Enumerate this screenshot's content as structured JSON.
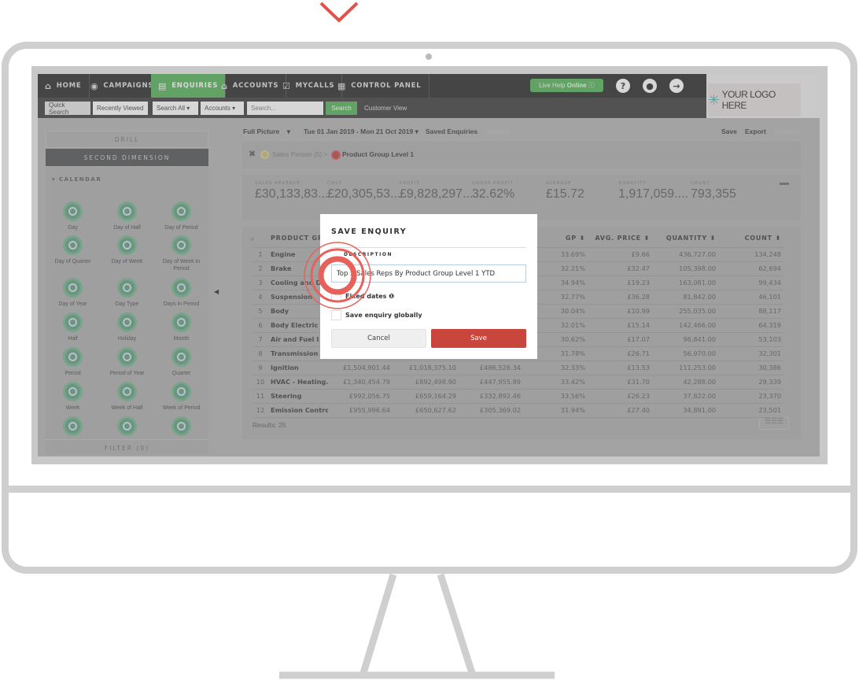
{
  "nav": {
    "items": [
      {
        "label": "HOME",
        "icon": "home-icon"
      },
      {
        "label": "CAMPAIGNS",
        "icon": "campaign-icon"
      },
      {
        "label": "ENQUIRIES",
        "icon": "enquiries-icon",
        "active": true
      },
      {
        "label": "ACCOUNTS",
        "icon": "bank-icon"
      },
      {
        "label": "MYCALLS",
        "icon": "checklist-icon"
      },
      {
        "label": "CONTROL PANEL",
        "icon": "control-panel-icon"
      }
    ],
    "live_help": "Live Help",
    "live_help_status": "Online",
    "logo_text": "YOUR LOGO HERE"
  },
  "subnav": {
    "quick_search": "Quick Search",
    "recently_viewed": "Recently Viewed",
    "search_all": "Search All",
    "accounts": "Accounts",
    "search_placeholder": "Search...",
    "search_button": "Search",
    "customer_view": "Customer View"
  },
  "sidebar": {
    "drill": "DRILL",
    "second_dimension": "SECOND DIMENSION",
    "calendar": "CALENDAR",
    "filter": "FILTER (0)",
    "tiles": [
      "Day",
      "Day of Half",
      "Day of Period",
      "Day of Quarter",
      "Day of Week",
      "Day of Week in Period",
      "Day of Year",
      "Day Type",
      "Days in Period",
      "Half",
      "Holiday",
      "Month",
      "Period",
      "Period of Year",
      "Quarter",
      "Week",
      "Week of Half",
      "Week of Period",
      "",
      "",
      ""
    ]
  },
  "toolbar": {
    "view": "Full Picture",
    "date_range": "Tue 01 Jan 2019 - Mon 21 Oct 2019",
    "saved": "Saved Enquiries",
    "enquiry": "Enquiry",
    "save": "Save",
    "export": "Export",
    "settings": "Settings"
  },
  "breadcrumb": {
    "first": "Sales Person (5) >",
    "second": "Product Group Level 1"
  },
  "kpis": [
    {
      "label": "SALES REVENUE",
      "value": "£30,133,83..."
    },
    {
      "label": "COST",
      "value": "£20,305,53..."
    },
    {
      "label": "PROFIT",
      "value": "£9,828,297..."
    },
    {
      "label": "GROSS PROFIT",
      "value": "32.62%"
    },
    {
      "label": "AVERAGE",
      "value": "£15.72"
    },
    {
      "label": "QUANTITY",
      "value": "1,917,059...."
    },
    {
      "label": "COUNT",
      "value": "793,355"
    }
  ],
  "table": {
    "headers": [
      "PRODUCT GR",
      "",
      "",
      "",
      "GP ⬍",
      "AVG. PRICE ⬍",
      "QUANTITY ⬍",
      "COUNT ⬍"
    ],
    "rows": [
      [
        "1",
        "Engine",
        "",
        "",
        "",
        "33.69%",
        "£9.66",
        "436,727.00",
        "134,248"
      ],
      [
        "2",
        "Brake",
        "",
        "",
        "",
        "32.21%",
        "£32.47",
        "105,398.00",
        "62,694"
      ],
      [
        "3",
        "Cooling and D",
        "",
        "",
        "",
        "34.94%",
        "£19.23",
        "163,081.00",
        "99,434"
      ],
      [
        "4",
        "Suspension",
        "",
        "",
        "",
        "32.77%",
        "£36.28",
        "81,842.00",
        "46,101"
      ],
      [
        "5",
        "Body",
        "",
        "",
        "",
        "30.04%",
        "£10.99",
        "255,035.00",
        "88,117"
      ],
      [
        "6",
        "Body Electric",
        "",
        "",
        "",
        "32.01%",
        "£15.14",
        "142,466.00",
        "64,319"
      ],
      [
        "7",
        "Air and Fuel I",
        "",
        "",
        "",
        "30.62%",
        "£17.07",
        "96,841.00",
        "53,103"
      ],
      [
        "8",
        "Transmission",
        "",
        "",
        "",
        "31.78%",
        "£26.71",
        "56,970.00",
        "32,301"
      ],
      [
        "9",
        "Ignition",
        "£1,504,901.44",
        "£1,018,375.10",
        "£486,526.34",
        "32.33%",
        "£13.53",
        "111,253.00",
        "30,386"
      ],
      [
        "10",
        "HVAC - Heating...",
        "£1,340,454.79",
        "£892,498.90",
        "£447,955.89",
        "33.42%",
        "£31.70",
        "42,288.00",
        "29,339"
      ],
      [
        "11",
        "Steering",
        "£992,056.75",
        "£659,164.29",
        "£332,892.46",
        "33.56%",
        "£26.23",
        "37,822.00",
        "23,370"
      ],
      [
        "12",
        "Emission Control",
        "£955,996.64",
        "£650,627.62",
        "£305,369.02",
        "31.94%",
        "£27.40",
        "34,891.00",
        "23,501"
      ]
    ],
    "results": "Results: 25"
  },
  "modal": {
    "title": "SAVE ENQUIRY",
    "desc_label": "DESCRIPTION",
    "desc_value": "Top 5 Sales Reps By Product Group Level 1 YTD",
    "fixed_dates": "Fixed dates",
    "save_globally": "Save enquiry globally",
    "cancel": "Cancel",
    "save": "Save"
  },
  "colors": {
    "accent": "#4caf50",
    "save": "#c9463d",
    "ring": "#e8605a"
  }
}
